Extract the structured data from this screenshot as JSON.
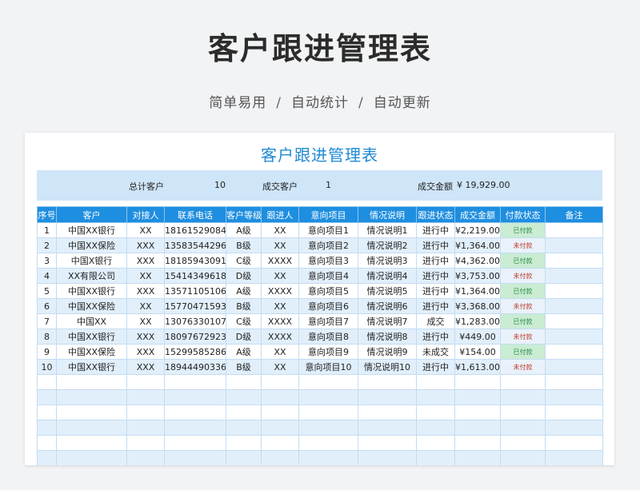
{
  "hero": {
    "title": "客户跟进管理表",
    "features": [
      "简单易用",
      "自动统计",
      "自动更新"
    ],
    "separator": "/"
  },
  "sheet": {
    "title": "客户跟进管理表",
    "summary": {
      "total_label": "总计客户",
      "total_value": "10",
      "deal_label": "成交客户",
      "deal_value": "1",
      "amount_label": "成交金额",
      "amount_value": "¥ 19,929.00"
    },
    "columns": [
      "序号",
      "客户",
      "对接人",
      "联系电话",
      "客户等级",
      "跟进人",
      "意向项目",
      "情况说明",
      "跟进状态",
      "成交金额",
      "付款状态",
      "备注"
    ],
    "rows": [
      [
        "1",
        "中国XX银行",
        "XX",
        "18161529084",
        "A级",
        "XX",
        "意向项目1",
        "情况说明1",
        "进行中",
        "¥2,219.00",
        "已付款",
        ""
      ],
      [
        "2",
        "中国XX保险",
        "XXX",
        "13583544296",
        "B级",
        "XX",
        "意向项目2",
        "情况说明2",
        "进行中",
        "¥1,364.00",
        "未付款",
        ""
      ],
      [
        "3",
        "中国X银行",
        "XXX",
        "18185943091",
        "C级",
        "XXXX",
        "意向项目3",
        "情况说明3",
        "进行中",
        "¥4,362.00",
        "已付款",
        ""
      ],
      [
        "4",
        "XX有限公司",
        "XX",
        "15414349618",
        "D级",
        "XX",
        "意向项目4",
        "情况说明4",
        "进行中",
        "¥3,753.00",
        "未付款",
        ""
      ],
      [
        "5",
        "中国XX银行",
        "XXX",
        "13571105106",
        "A级",
        "XXXX",
        "意向项目5",
        "情况说明5",
        "进行中",
        "¥1,364.00",
        "已付款",
        ""
      ],
      [
        "6",
        "中国XX保险",
        "XX",
        "15770471593",
        "B级",
        "XX",
        "意向项目6",
        "情况说明6",
        "进行中",
        "¥3,368.00",
        "未付款",
        ""
      ],
      [
        "7",
        "中国XX",
        "XX",
        "13076330107",
        "C级",
        "XXXX",
        "意向项目7",
        "情况说明7",
        "成交",
        "¥1,283.00",
        "已付款",
        ""
      ],
      [
        "8",
        "中国XX银行",
        "XXX",
        "18097672923",
        "D级",
        "XXXX",
        "意向项目8",
        "情况说明8",
        "进行中",
        "¥449.00",
        "未付款",
        ""
      ],
      [
        "9",
        "中国XX保险",
        "XXX",
        "15299585286",
        "A级",
        "XX",
        "意向项目9",
        "情况说明9",
        "未成交",
        "¥154.00",
        "已付款",
        ""
      ],
      [
        "10",
        "中国XX银行",
        "XXX",
        "18944490336",
        "B级",
        "XX",
        "意向项目10",
        "情况说明10",
        "进行中",
        "¥1,613.00",
        "未付款",
        ""
      ]
    ],
    "empty_rows": 6,
    "colors": {
      "accent": "#1e8ee0",
      "title": "#1f8ad6",
      "paid_bg": "#c9ecd3",
      "unpaid_text": "#c0392b"
    }
  }
}
